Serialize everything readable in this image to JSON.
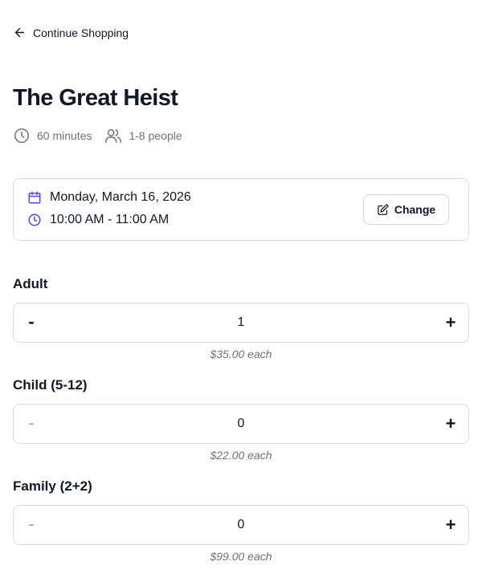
{
  "nav": {
    "back_label": "Continue Shopping",
    "back_icon": "arrow-left-icon"
  },
  "experience": {
    "title": "The Great Heist",
    "duration": "60 minutes",
    "group_size": "1-8 people"
  },
  "booking": {
    "date": "Monday, March 16, 2026",
    "time": "10:00 AM - 11:00 AM",
    "change_label": "Change",
    "accent_color": "#4f46e5"
  },
  "tickets": [
    {
      "label": "Adult",
      "quantity": "1",
      "price_note": "$35.00 each",
      "minus": "-",
      "plus": "+",
      "minus_disabled": false
    },
    {
      "label": "Child (5-12)",
      "quantity": "0",
      "price_note": "$22.00 each",
      "minus": "-",
      "plus": "+",
      "minus_disabled": true
    },
    {
      "label": "Family (2+2)",
      "quantity": "0",
      "price_note": "$99.00 each",
      "minus": "-",
      "plus": "+",
      "minus_disabled": true
    }
  ]
}
